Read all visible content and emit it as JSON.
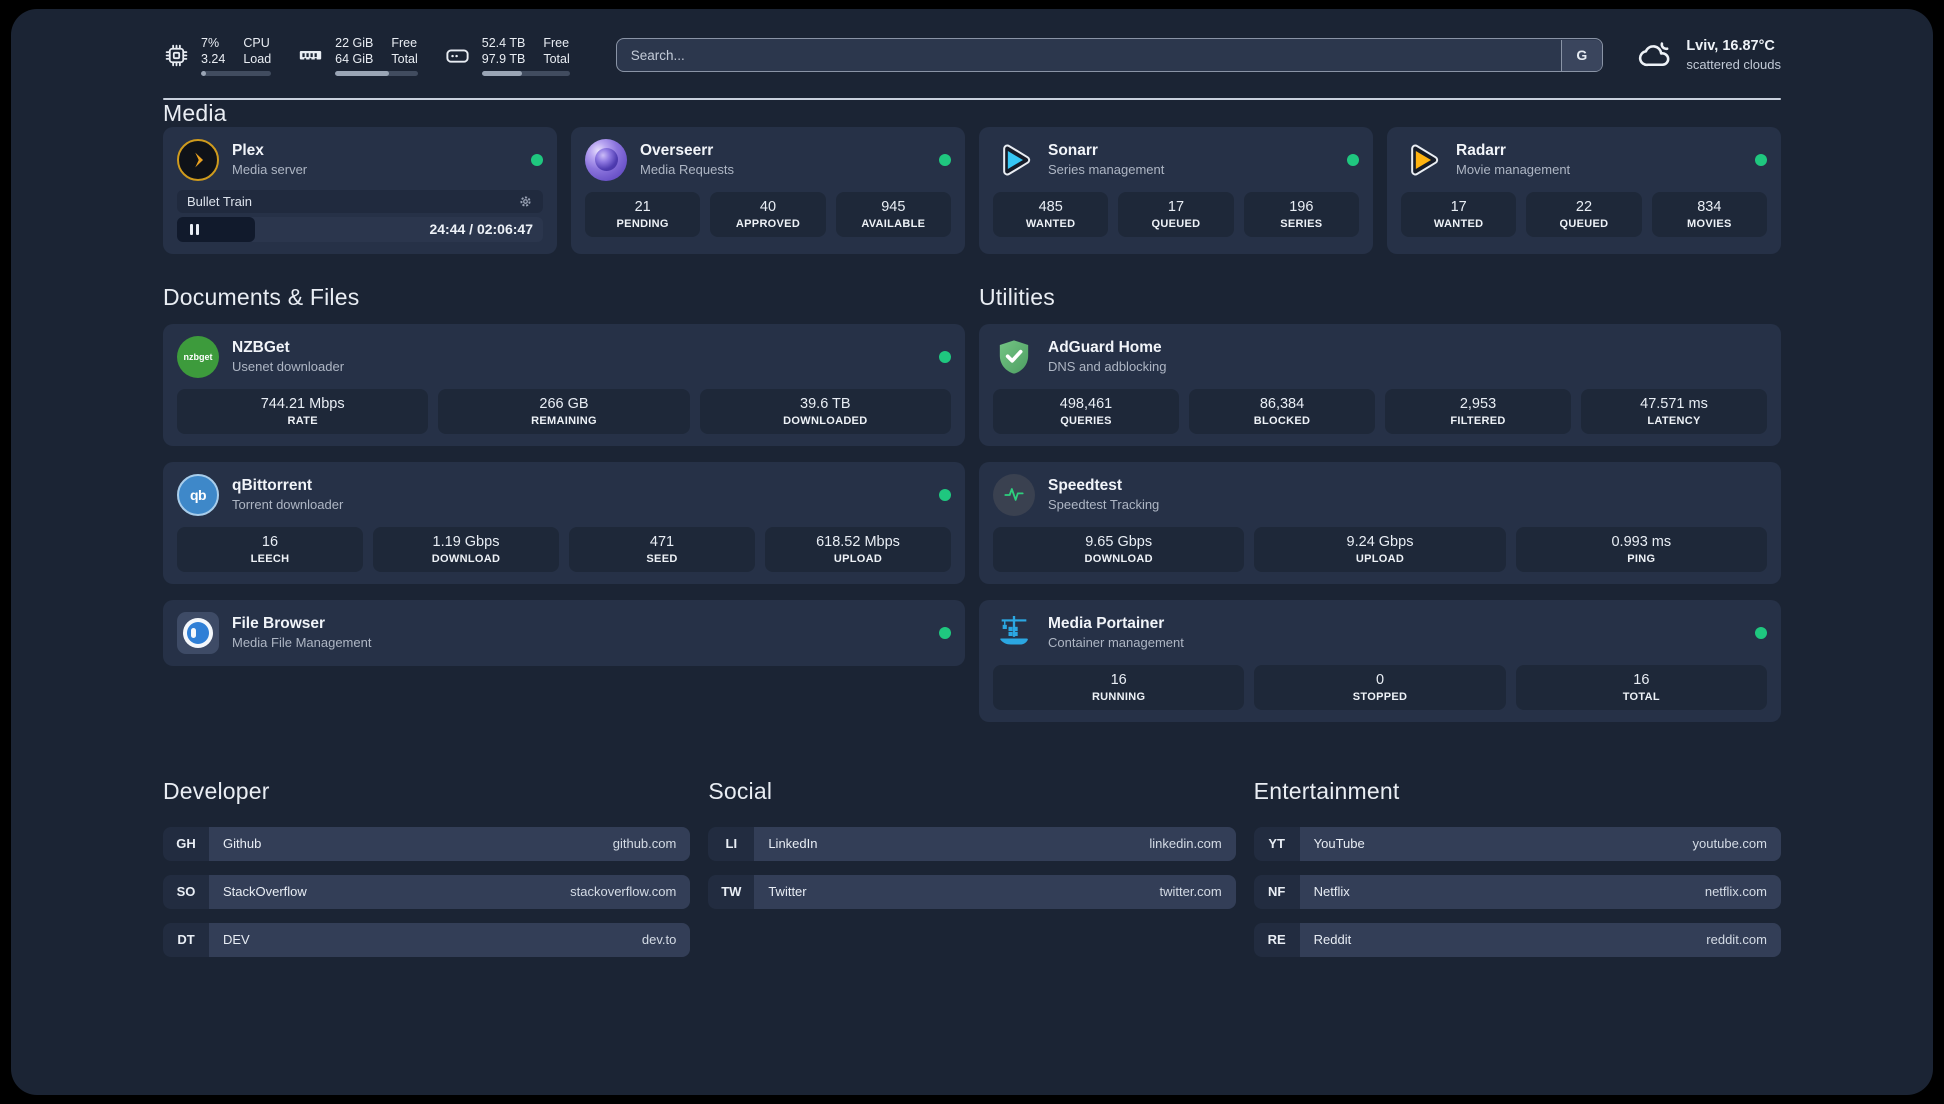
{
  "header": {
    "cpu": {
      "value_top": "7%",
      "value_bottom": "3.24",
      "label_top": "CPU",
      "label_bottom": "Load",
      "progress_pct": 7
    },
    "memory": {
      "value_top": "22 GiB",
      "value_bottom": "64 GiB",
      "label_top": "Free",
      "label_bottom": "Total",
      "progress_pct": 65
    },
    "storage": {
      "value_top": "52.4 TB",
      "value_bottom": "97.9 TB",
      "label_top": "Free",
      "label_bottom": "Total",
      "progress_pct": 46
    },
    "search": {
      "placeholder": "Search...",
      "button_label": "G"
    },
    "weather": {
      "location": "Lviv, 16.87°C",
      "condition": "scattered clouds"
    }
  },
  "sections": {
    "media": "Media",
    "documents": "Documents & Files",
    "utilities": "Utilities",
    "developer": "Developer",
    "social": "Social",
    "entertainment": "Entertainment"
  },
  "colors": {
    "status_online": "#1fc77f",
    "plex_gold": "#e8a121",
    "sonarr_blue": "#36c6f4",
    "radarr_yellow": "#ffb310",
    "nzbget_green": "#3d9b3c",
    "adguard_green": "#63b168",
    "qbittorrent_blue": "#3e88c9",
    "speedtest_green": "#2ecf7d",
    "portainer_blue": "#2ba7e2"
  },
  "apps": {
    "plex": {
      "name": "Plex",
      "desc": "Media server",
      "status": "online",
      "now_playing": "Bullet Train",
      "time": "24:44 / 02:06:47"
    },
    "overseerr": {
      "name": "Overseerr",
      "desc": "Media Requests",
      "status": "online",
      "stats": [
        {
          "value": "21",
          "label": "PENDING"
        },
        {
          "value": "40",
          "label": "APPROVED"
        },
        {
          "value": "945",
          "label": "AVAILABLE"
        }
      ]
    },
    "sonarr": {
      "name": "Sonarr",
      "desc": "Series management",
      "status": "online",
      "stats": [
        {
          "value": "485",
          "label": "WANTED"
        },
        {
          "value": "17",
          "label": "QUEUED"
        },
        {
          "value": "196",
          "label": "SERIES"
        }
      ]
    },
    "radarr": {
      "name": "Radarr",
      "desc": "Movie management",
      "status": "online",
      "stats": [
        {
          "value": "17",
          "label": "WANTED"
        },
        {
          "value": "22",
          "label": "QUEUED"
        },
        {
          "value": "834",
          "label": "MOVIES"
        }
      ]
    },
    "nzbget": {
      "name": "NZBGet",
      "desc": "Usenet downloader",
      "status": "online",
      "icon_text": "nzbget",
      "stats": [
        {
          "value": "744.21 Mbps",
          "label": "RATE"
        },
        {
          "value": "266 GB",
          "label": "REMAINING"
        },
        {
          "value": "39.6 TB",
          "label": "DOWNLOADED"
        }
      ]
    },
    "adguard": {
      "name": "AdGuard Home",
      "desc": "DNS and adblocking",
      "stats": [
        {
          "value": "498,461",
          "label": "QUERIES"
        },
        {
          "value": "86,384",
          "label": "BLOCKED"
        },
        {
          "value": "2,953",
          "label": "FILTERED"
        },
        {
          "value": "47.571 ms",
          "label": "LATENCY"
        }
      ]
    },
    "qbittorrent": {
      "name": "qBittorrent",
      "desc": "Torrent downloader",
      "status": "online",
      "icon_text": "qb",
      "stats": [
        {
          "value": "16",
          "label": "LEECH"
        },
        {
          "value": "1.19 Gbps",
          "label": "DOWNLOAD"
        },
        {
          "value": "471",
          "label": "SEED"
        },
        {
          "value": "618.52 Mbps",
          "label": "UPLOAD"
        }
      ]
    },
    "speedtest": {
      "name": "Speedtest",
      "desc": "Speedtest Tracking",
      "stats": [
        {
          "value": "9.65 Gbps",
          "label": "DOWNLOAD"
        },
        {
          "value": "9.24 Gbps",
          "label": "UPLOAD"
        },
        {
          "value": "0.993 ms",
          "label": "PING"
        }
      ]
    },
    "filebrowser": {
      "name": "File Browser",
      "desc": "Media File Management",
      "status": "online"
    },
    "portainer": {
      "name": "Media Portainer",
      "desc": "Container management",
      "status": "online",
      "stats": [
        {
          "value": "16",
          "label": "RUNNING"
        },
        {
          "value": "0",
          "label": "STOPPED"
        },
        {
          "value": "16",
          "label": "TOTAL"
        }
      ]
    }
  },
  "links": {
    "developer": [
      {
        "abbr": "GH",
        "name": "Github",
        "url": "github.com"
      },
      {
        "abbr": "SO",
        "name": "StackOverflow",
        "url": "stackoverflow.com"
      },
      {
        "abbr": "DT",
        "name": "DEV",
        "url": "dev.to"
      }
    ],
    "social": [
      {
        "abbr": "LI",
        "name": "LinkedIn",
        "url": "linkedin.com"
      },
      {
        "abbr": "TW",
        "name": "Twitter",
        "url": "twitter.com"
      }
    ],
    "entertainment": [
      {
        "abbr": "YT",
        "name": "YouTube",
        "url": "youtube.com"
      },
      {
        "abbr": "NF",
        "name": "Netflix",
        "url": "netflix.com"
      },
      {
        "abbr": "RE",
        "name": "Reddit",
        "url": "reddit.com"
      }
    ]
  }
}
